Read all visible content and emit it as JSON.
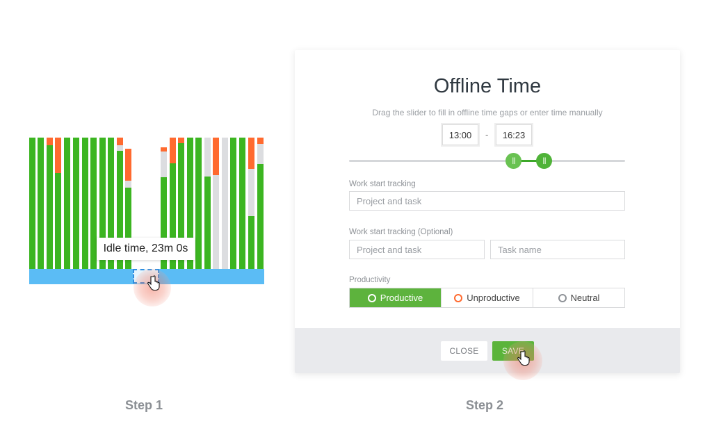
{
  "step1": {
    "label": "Step 1",
    "tooltip": "Idle time, 23m 0s",
    "colors": {
      "productive": "#3cb521",
      "unproductive": "#ff6a2f",
      "neutral": "#dcdde0",
      "idle_band": "#5bbcf5",
      "selection": "#2f8ee0"
    },
    "timeline_bars_left": [
      [
        [
          "productive",
          1.0
        ]
      ],
      [
        [
          "productive",
          1.0
        ]
      ],
      [
        [
          "unproductive",
          0.06
        ],
        [
          "productive",
          0.94
        ]
      ],
      [
        [
          "unproductive",
          0.27
        ],
        [
          "productive",
          0.73
        ]
      ],
      [
        [
          "productive",
          1.0
        ]
      ],
      [
        [
          "productive",
          1.0
        ]
      ],
      [
        [
          "productive",
          1.0
        ]
      ],
      [
        [
          "productive",
          1.0
        ]
      ],
      [
        [
          "productive",
          1.0
        ]
      ],
      [
        [
          "productive",
          1.0
        ]
      ],
      [
        [
          "unproductive",
          0.06
        ],
        [
          "neutral",
          0.04
        ],
        [
          "productive",
          0.9
        ]
      ],
      [
        [
          "empty",
          0.085
        ],
        [
          "unproductive",
          0.245
        ],
        [
          "neutral",
          0.05
        ],
        [
          "productive",
          0.62
        ]
      ]
    ],
    "timeline_bars_right": [
      [
        [
          "empty",
          0.075
        ],
        [
          "unproductive",
          0.03
        ],
        [
          "neutral",
          0.195
        ],
        [
          "productive",
          0.7
        ]
      ],
      [
        [
          "unproductive",
          0.195
        ],
        [
          "productive",
          0.805
        ]
      ],
      [
        [
          "unproductive",
          0.04
        ],
        [
          "productive",
          0.96
        ]
      ],
      [
        [
          "productive",
          1.0
        ]
      ],
      [
        [
          "productive",
          1.0
        ]
      ],
      [
        [
          "neutral",
          0.295
        ],
        [
          "productive",
          0.705
        ]
      ],
      [
        [
          "unproductive",
          0.285
        ],
        [
          "neutral",
          0.715
        ]
      ],
      [
        [
          "neutral",
          1.0
        ]
      ],
      [
        [
          "productive",
          1.0
        ]
      ],
      [
        [
          "productive",
          1.0
        ]
      ],
      [
        [
          "unproductive",
          0.24
        ],
        [
          "neutral",
          0.36
        ],
        [
          "productive",
          0.4
        ]
      ],
      [
        [
          "unproductive",
          0.05
        ],
        [
          "neutral",
          0.15
        ],
        [
          "productive",
          0.8
        ]
      ]
    ]
  },
  "dialog": {
    "title": "Offline Time",
    "subtitle": "Drag the slider to fill in offline time gaps or enter time manually",
    "time_start": "13:00",
    "time_separator": "-",
    "time_end": "16:23",
    "slider_handle_glyph": "|||",
    "fields": {
      "work_start_label": "Work start tracking",
      "project_placeholder": "Project and task",
      "optional_label": "Work start tracking (Optional)",
      "optional_project_placeholder": "Project and task",
      "task_name_placeholder": "Task name"
    },
    "productivity": {
      "label": "Productivity",
      "options": [
        {
          "label": "Productive",
          "selected": true,
          "ring_color": "#ffffff"
        },
        {
          "label": "Unproductive",
          "selected": false,
          "ring_color": "#ff6a2f"
        },
        {
          "label": "Neutral",
          "selected": false,
          "ring_color": "#8e9297"
        }
      ]
    },
    "footer": {
      "close_label": "CLOSE",
      "save_label": "SAVE"
    }
  },
  "step2": {
    "label": "Step 2"
  }
}
